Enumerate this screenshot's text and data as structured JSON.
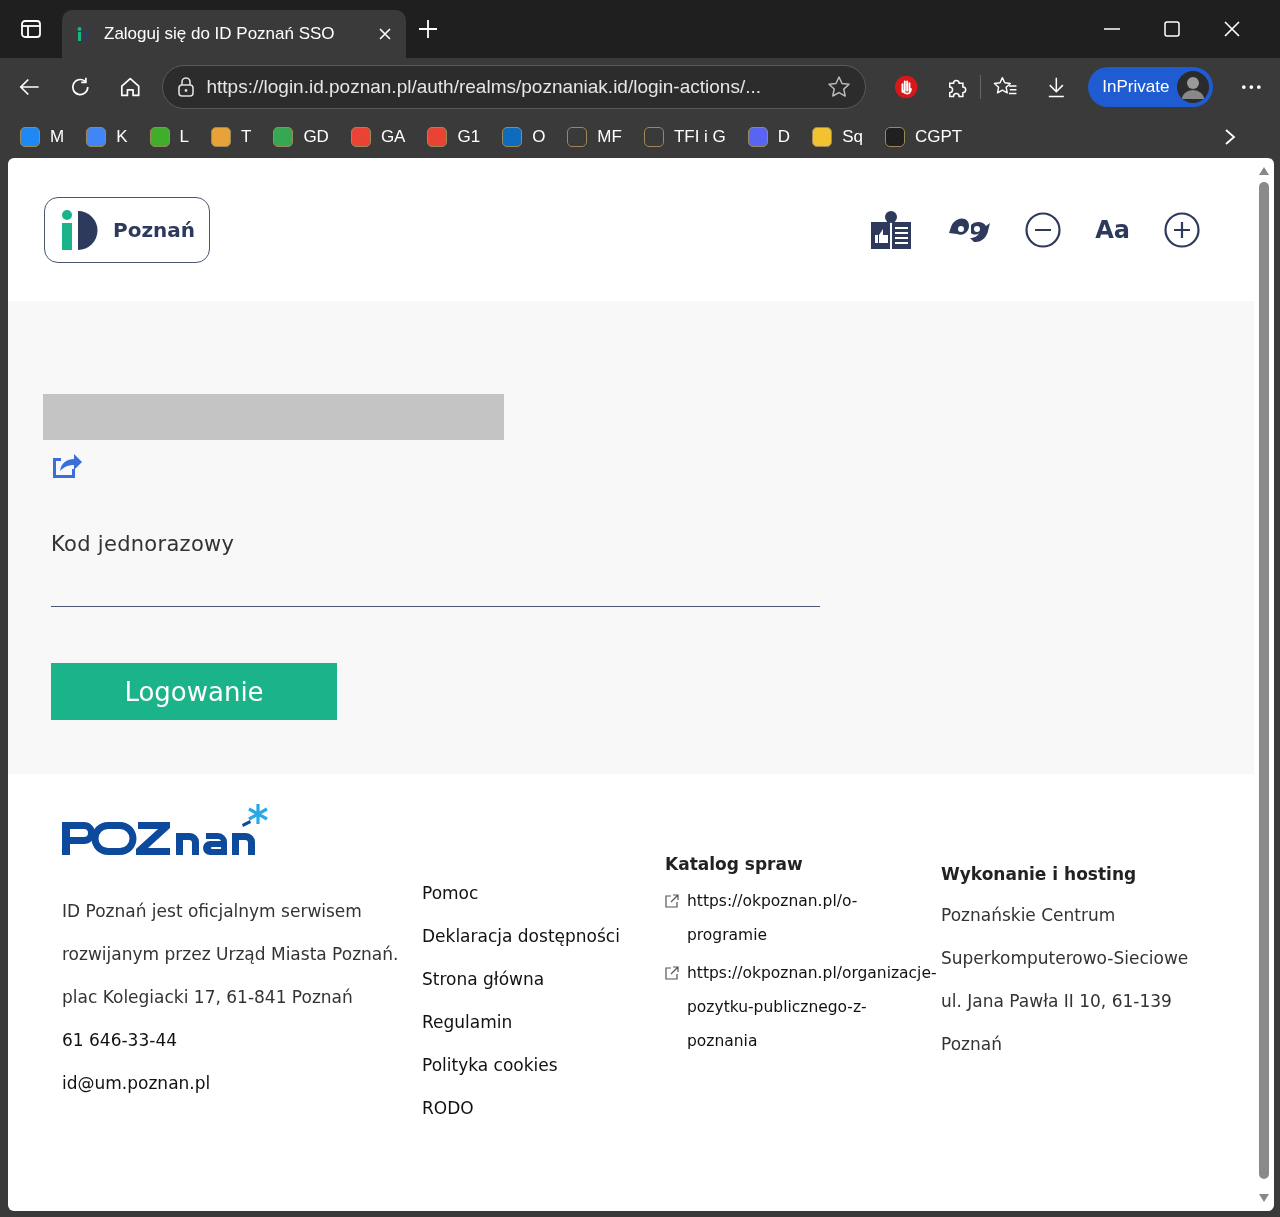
{
  "browser": {
    "tab_title": "Zaloguj się do ID Poznań SSO",
    "url": "https://login.id.poznan.pl/auth/realms/poznaniak.id/login-actions/...",
    "profile_label": "InPrivate",
    "bookmarks": [
      {
        "label": "M",
        "color": "#1e88f5"
      },
      {
        "label": "K",
        "color": "#4285f4"
      },
      {
        "label": "L",
        "color": "#3fae2a"
      },
      {
        "label": "T",
        "color": "#e8a23a"
      },
      {
        "label": "GD",
        "color": "#34a853"
      },
      {
        "label": "GA",
        "color": "#ea4335"
      },
      {
        "label": "G1",
        "color": "#ea4335"
      },
      {
        "label": "O",
        "color": "#0f6cbd"
      },
      {
        "label": "MF",
        "color": "#3a3a3a"
      },
      {
        "label": "TFI i G",
        "color": "#3a3a3a"
      },
      {
        "label": "D",
        "color": "#5865f2"
      },
      {
        "label": "Sq",
        "color": "#f2c230"
      },
      {
        "label": "CGPT",
        "color": "#202020"
      }
    ]
  },
  "header": {
    "logo_text": "Poznań",
    "font_size_label": "Aa"
  },
  "form": {
    "field_label": "Kod jednorazowy",
    "submit": "Logowanie"
  },
  "footer": {
    "about": [
      "ID Poznań jest oficjalnym serwisem",
      "rozwijanym przez Urząd Miasta Poznań.",
      "plac Kolegiacki 17, 61-841 Poznań"
    ],
    "phone": "61 646-33-44",
    "email": "id@um.poznan.pl",
    "links": [
      "Pomoc",
      "Deklaracja dostępności",
      "Strona główna",
      "Regulamin",
      "Polityka cookies",
      "RODO"
    ],
    "catalog_title": "Katalog spraw",
    "catalog_links": [
      "https://okpoznan.pl/o-programie",
      "https://okpoznan.pl/organizacje-pozytku-publicznego-z-poznania"
    ],
    "hosting_title": "Wykonanie i hosting",
    "hosting_lines": [
      "Poznańskie Centrum",
      "Superkomputerowo-Sieciowe",
      "ul. Jana Pawła II 10, 61-139",
      "Poznań"
    ]
  }
}
